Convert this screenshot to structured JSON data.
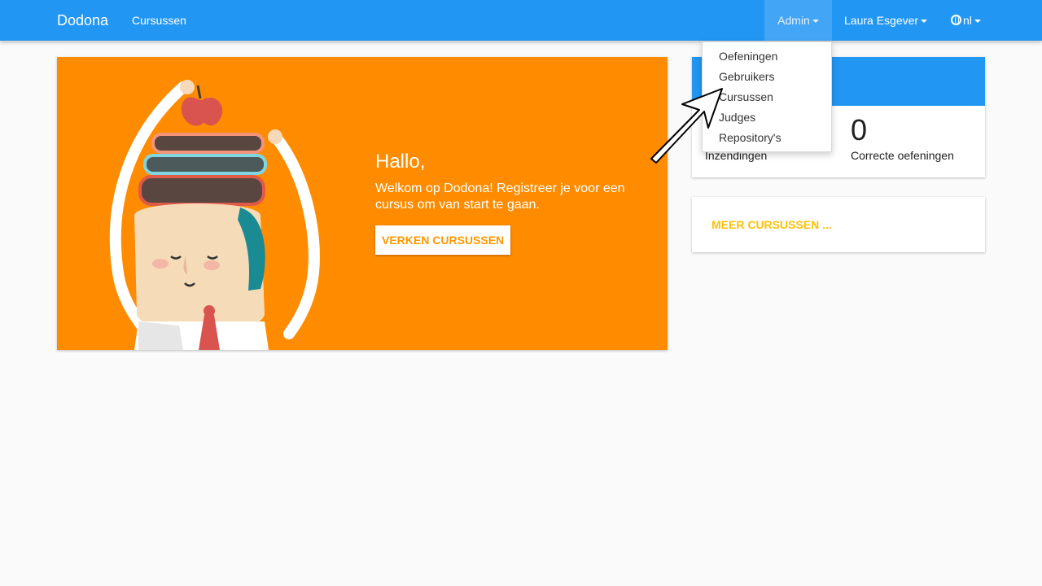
{
  "navbar": {
    "brand": "Dodona",
    "courses_link": "Cursussen",
    "admin_label": "Admin",
    "user_label": "Laura Esgever",
    "lang_label": "nl"
  },
  "admin_menu": {
    "items": [
      "Oefeningen",
      "Gebruikers",
      "Cursussen",
      "Judges",
      "Repository's"
    ]
  },
  "hero": {
    "title": "Hallo,",
    "subtitle": "Welkom op Dodona! Registreer je voor een cursus om van start te gaan.",
    "button_label": "Verken cursussen"
  },
  "stats": {
    "submissions_label": "Inzendingen",
    "correct_value": "0",
    "correct_label": "Correcte oefeningen"
  },
  "more_courses": {
    "link_label": "MEER CURSUSSEN ..."
  },
  "colors": {
    "navbar": "#2196f3",
    "hero_bg": "#ff8c00",
    "accent": "#ffc107"
  }
}
